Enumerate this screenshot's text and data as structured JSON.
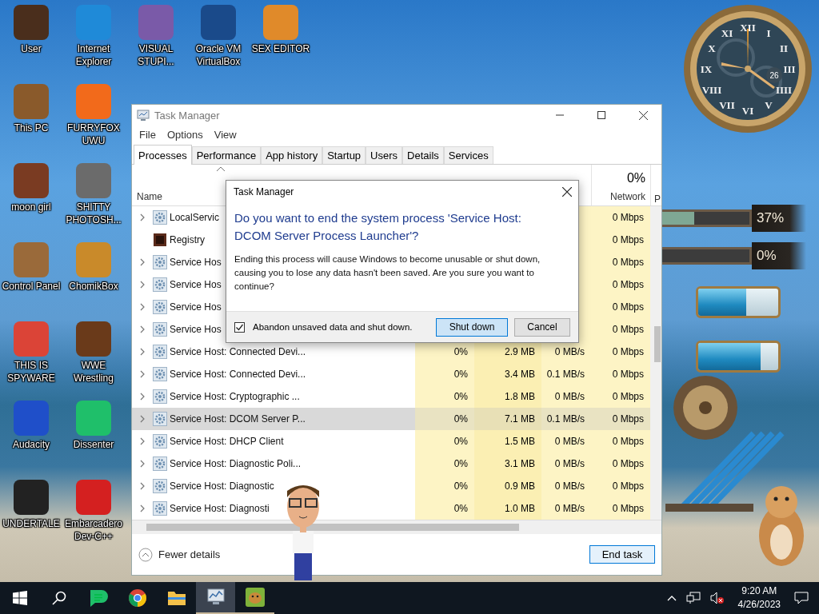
{
  "desktop_icons": [
    {
      "label": "User",
      "color": "#4a2e1c"
    },
    {
      "label": "This PC",
      "color": "#8a5a2b"
    },
    {
      "label": "moon girl",
      "color": "#7a3b22"
    },
    {
      "label": "Control Panel",
      "color": "#9a6a3a"
    },
    {
      "label": "THIS IS SPYWARE",
      "color": "#db4437"
    },
    {
      "label": "Audacity",
      "color": "#1f4fc9"
    },
    {
      "label": "UNDERTALE",
      "color": "#222222"
    },
    {
      "label": "Internet Explorer",
      "color": "#1f8ad8"
    },
    {
      "label": "FURRYFOX UWU",
      "color": "#f26a1b"
    },
    {
      "label": "SHITTY PHOTOSH...",
      "color": "#6b6b6b"
    },
    {
      "label": "ChomikBox",
      "color": "#c98a2a"
    },
    {
      "label": "WWE Wrestling",
      "color": "#6a3a1a"
    },
    {
      "label": "Dissenter",
      "color": "#1fbf6a"
    },
    {
      "label": "Embarcadero Dev-C++",
      "color": "#d42020"
    },
    {
      "label": "VISUAL STUPI...",
      "color": "#7a5aa8"
    },
    {
      "label": "Oracle VM VirtualBox",
      "color": "#1a4a8a"
    },
    {
      "label": "SEX EDITOR",
      "color": "#e08a2a"
    }
  ],
  "task_manager": {
    "title": "Task Manager",
    "menu": [
      "File",
      "Options",
      "View"
    ],
    "tabs": [
      {
        "label": "Processes",
        "selected": true
      },
      {
        "label": "Performance",
        "selected": false
      },
      {
        "label": "App history",
        "selected": false
      },
      {
        "label": "Startup",
        "selected": false
      },
      {
        "label": "Users",
        "selected": false
      },
      {
        "label": "Details",
        "selected": false
      },
      {
        "label": "Services",
        "selected": false
      }
    ],
    "header": {
      "name": "Name",
      "network_percent": "0%",
      "network": "Network",
      "cut_column": "P"
    },
    "rows": [
      {
        "name": "LocalServic",
        "kind": "service",
        "expandable": true,
        "selected": false,
        "network": "0 Mbps"
      },
      {
        "name": "Registry",
        "kind": "registry",
        "expandable": false,
        "selected": false,
        "network": "0 Mbps"
      },
      {
        "name": "Service Hos",
        "kind": "service",
        "expandable": true,
        "selected": false,
        "network": "0 Mbps"
      },
      {
        "name": "Service Hos",
        "kind": "service",
        "expandable": true,
        "selected": false,
        "network": "0 Mbps"
      },
      {
        "name": "Service Hos",
        "kind": "service",
        "expandable": true,
        "selected": false,
        "network": "0 Mbps"
      },
      {
        "name": "Service Hos",
        "kind": "service",
        "expandable": true,
        "selected": false,
        "network": "0 Mbps"
      },
      {
        "name": "Service Host: Connected Devi...",
        "kind": "service",
        "expandable": true,
        "selected": false,
        "cpu": "0%",
        "memory": "2.9 MB",
        "disk": "0 MB/s",
        "network": "0 Mbps"
      },
      {
        "name": "Service Host: Connected Devi...",
        "kind": "service",
        "expandable": true,
        "selected": false,
        "cpu": "0%",
        "memory": "3.4 MB",
        "disk": "0.1 MB/s",
        "network": "0 Mbps"
      },
      {
        "name": "Service Host: Cryptographic ...",
        "kind": "service",
        "expandable": true,
        "selected": false,
        "cpu": "0%",
        "memory": "1.8 MB",
        "disk": "0 MB/s",
        "network": "0 Mbps"
      },
      {
        "name": "Service Host: DCOM Server P...",
        "kind": "service",
        "expandable": true,
        "selected": true,
        "cpu": "0%",
        "memory": "7.1 MB",
        "disk": "0.1 MB/s",
        "network": "0 Mbps"
      },
      {
        "name": "Service Host: DHCP Client",
        "kind": "service",
        "expandable": true,
        "selected": false,
        "cpu": "0%",
        "memory": "1.5 MB",
        "disk": "0 MB/s",
        "network": "0 Mbps"
      },
      {
        "name": "Service Host: Diagnostic Poli...",
        "kind": "service",
        "expandable": true,
        "selected": false,
        "cpu": "0%",
        "memory": "3.1 MB",
        "disk": "0 MB/s",
        "network": "0 Mbps"
      },
      {
        "name": "Service Host: Diagnostic",
        "kind": "service",
        "expandable": true,
        "selected": false,
        "cpu": "0%",
        "memory": "0.9 MB",
        "disk": "0 MB/s",
        "network": "0 Mbps"
      },
      {
        "name": "Service Host: Diagnosti",
        "kind": "service",
        "expandable": true,
        "selected": false,
        "cpu": "0%",
        "memory": "1.0 MB",
        "disk": "0 MB/s",
        "network": "0 Mbps"
      }
    ],
    "fewer_details": "Fewer details",
    "end_task": "End task"
  },
  "dialog": {
    "title": "Task Manager",
    "heading": "Do you want to end the system process 'Service Host: DCOM Server Process Launcher'?",
    "body": "Ending this process will cause Windows to become unusable or shut down, causing you to lose any data hasn't been saved. Are you sure you want to continue?",
    "checkbox": {
      "label": "Abandon unsaved data and shut down.",
      "checked": true
    },
    "buttons": [
      {
        "label": "Shut down",
        "kind": "default"
      },
      {
        "label": "Cancel",
        "kind": "normal"
      }
    ]
  },
  "gadgets": {
    "clock": {
      "numerals": [
        "XII",
        "XI",
        "I",
        "X",
        "II",
        "IX",
        "III",
        "VIII",
        "IIII",
        "VII",
        "V",
        "VI"
      ],
      "date": "26"
    },
    "meters": [
      {
        "label": "37%",
        "level": 0.37
      },
      {
        "label": "0%",
        "level": 0
      }
    ],
    "tubes": [
      {
        "level": 0.6
      },
      {
        "level": 0.78
      }
    ]
  },
  "taskbar": {
    "apps": [
      {
        "kind": "start",
        "running": false
      },
      {
        "kind": "search",
        "running": false
      },
      {
        "kind": "dissenter",
        "running": false
      },
      {
        "kind": "chrome",
        "running": false
      },
      {
        "kind": "explorer",
        "running": false
      },
      {
        "kind": "task-manager",
        "running": true
      },
      {
        "kind": "chomikbox",
        "running": true
      }
    ],
    "time": "9:20 AM",
    "date": "4/26/2023"
  }
}
